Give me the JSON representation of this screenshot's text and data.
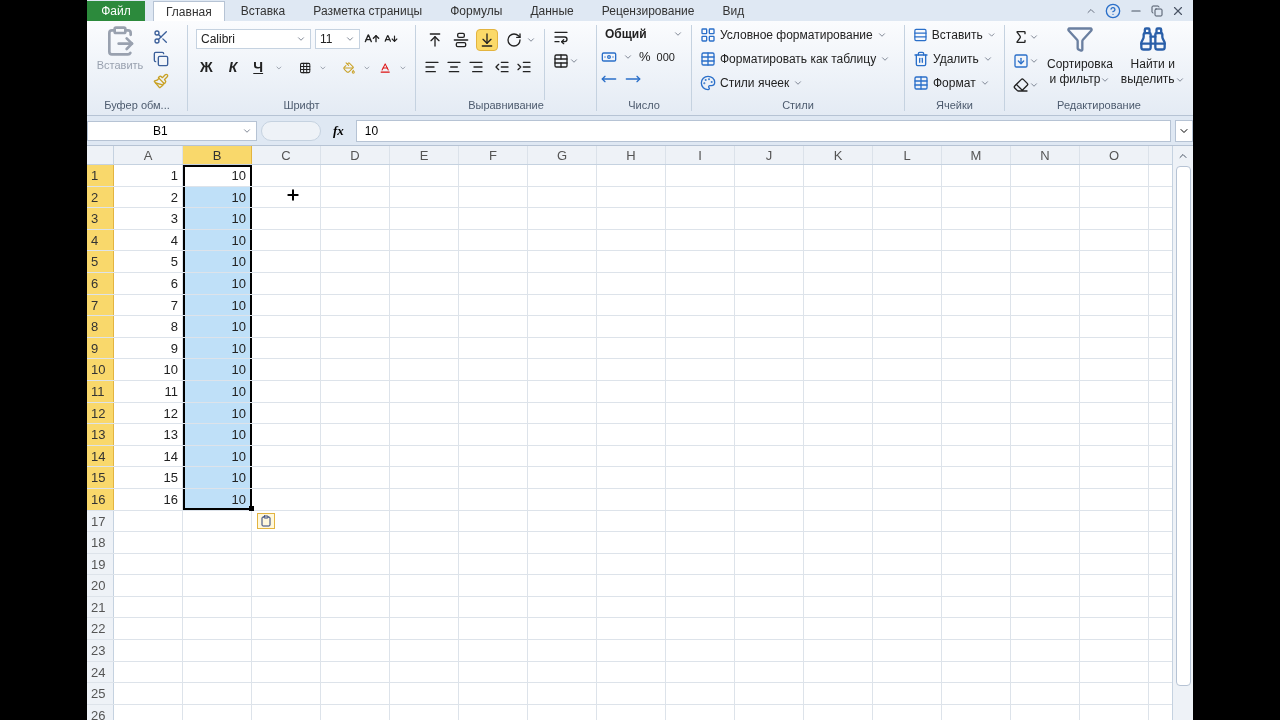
{
  "file_tab": "Файл",
  "tabs": [
    {
      "label": "Главная",
      "selected": true
    },
    {
      "label": "Вставка",
      "selected": false
    },
    {
      "label": "Разметка страницы",
      "selected": false
    },
    {
      "label": "Формулы",
      "selected": false
    },
    {
      "label": "Данные",
      "selected": false
    },
    {
      "label": "Рецензирование",
      "selected": false
    },
    {
      "label": "Вид",
      "selected": false
    }
  ],
  "clipboard": {
    "paste_label": "Вставить",
    "group_label": "Буфер обм..."
  },
  "font": {
    "font_name": "Calibri",
    "font_size": "11",
    "bold": "Ж",
    "italic": "К",
    "underline": "Ч",
    "group_label": "Шрифт"
  },
  "alignment": {
    "vertical": [
      {
        "kind": "top",
        "selected": false
      },
      {
        "kind": "middle",
        "selected": false
      },
      {
        "kind": "bottom",
        "selected": true
      }
    ],
    "group_label": "Выравнивание"
  },
  "number": {
    "format": "Общий",
    "percent": "%",
    "thousands": "000",
    "group_label": "Число"
  },
  "styles": {
    "items": [
      {
        "kind": "conditional",
        "label": "Условное форматирование"
      },
      {
        "kind": "table",
        "label": "Форматировать как таблицу"
      },
      {
        "kind": "cell",
        "label": "Стили ячеек"
      }
    ],
    "group_label": "Стили"
  },
  "cells": {
    "items": [
      {
        "kind": "insert",
        "label": "Вставить"
      },
      {
        "kind": "delete",
        "label": "Удалить"
      },
      {
        "kind": "format",
        "label": "Формат"
      }
    ],
    "group_label": "Ячейки"
  },
  "editing": {
    "sort": [
      "Сортировка",
      "и фильтр"
    ],
    "find": [
      "Найти и",
      "выделить"
    ],
    "group_label": "Редактирование"
  },
  "formula_bar": {
    "name_box": "B1",
    "function_label": "fx",
    "value": "10"
  },
  "columns": [
    {
      "label": "A",
      "selected": false
    },
    {
      "label": "B",
      "selected": true
    },
    {
      "label": "C",
      "selected": false
    },
    {
      "label": "D",
      "selected": false
    },
    {
      "label": "E",
      "selected": false
    },
    {
      "label": "F",
      "selected": false
    },
    {
      "label": "G",
      "selected": false
    },
    {
      "label": "H",
      "selected": false
    },
    {
      "label": "I",
      "selected": false
    },
    {
      "label": "J",
      "selected": false
    },
    {
      "label": "K",
      "selected": false
    },
    {
      "label": "L",
      "selected": false
    },
    {
      "label": "M",
      "selected": false
    },
    {
      "label": "N",
      "selected": false
    },
    {
      "label": "O",
      "selected": false
    }
  ],
  "rows": [
    {
      "label": "1",
      "selected": true,
      "cells": [
        {
          "value": "1",
          "selected": false
        },
        {
          "value": "10",
          "selected": true,
          "active": true
        }
      ]
    },
    {
      "label": "2",
      "selected": true,
      "cells": [
        {
          "value": "2",
          "selected": false
        },
        {
          "value": "10",
          "selected": true,
          "active": false
        }
      ]
    },
    {
      "label": "3",
      "selected": true,
      "cells": [
        {
          "value": "3",
          "selected": false
        },
        {
          "value": "10",
          "selected": true,
          "active": false
        }
      ]
    },
    {
      "label": "4",
      "selected": true,
      "cells": [
        {
          "value": "4",
          "selected": false
        },
        {
          "value": "10",
          "selected": true,
          "active": false
        }
      ]
    },
    {
      "label": "5",
      "selected": true,
      "cells": [
        {
          "value": "5",
          "selected": false
        },
        {
          "value": "10",
          "selected": true,
          "active": false
        }
      ]
    },
    {
      "label": "6",
      "selected": true,
      "cells": [
        {
          "value": "6",
          "selected": false
        },
        {
          "value": "10",
          "selected": true,
          "active": false
        }
      ]
    },
    {
      "label": "7",
      "selected": true,
      "cells": [
        {
          "value": "7",
          "selected": false
        },
        {
          "value": "10",
          "selected": true,
          "active": false
        }
      ]
    },
    {
      "label": "8",
      "selected": true,
      "cells": [
        {
          "value": "8",
          "selected": false
        },
        {
          "value": "10",
          "selected": true,
          "active": false
        }
      ]
    },
    {
      "label": "9",
      "selected": true,
      "cells": [
        {
          "value": "9",
          "selected": false
        },
        {
          "value": "10",
          "selected": true,
          "active": false
        }
      ]
    },
    {
      "label": "10",
      "selected": true,
      "cells": [
        {
          "value": "10",
          "selected": false
        },
        {
          "value": "10",
          "selected": true,
          "active": false
        }
      ]
    },
    {
      "label": "11",
      "selected": true,
      "cells": [
        {
          "value": "11",
          "selected": false
        },
        {
          "value": "10",
          "selected": true,
          "active": false
        }
      ]
    },
    {
      "label": "12",
      "selected": true,
      "cells": [
        {
          "value": "12",
          "selected": false
        },
        {
          "value": "10",
          "selected": true,
          "active": false
        }
      ]
    },
    {
      "label": "13",
      "selected": true,
      "cells": [
        {
          "value": "13",
          "selected": false
        },
        {
          "value": "10",
          "selected": true,
          "active": false
        }
      ]
    },
    {
      "label": "14",
      "selected": true,
      "cells": [
        {
          "value": "14",
          "selected": false
        },
        {
          "value": "10",
          "selected": true,
          "active": false
        }
      ]
    },
    {
      "label": "15",
      "selected": true,
      "cells": [
        {
          "value": "15",
          "selected": false
        },
        {
          "value": "10",
          "selected": true,
          "active": false
        }
      ]
    },
    {
      "label": "16",
      "selected": true,
      "cells": [
        {
          "value": "16",
          "selected": false
        },
        {
          "value": "10",
          "selected": true,
          "active": false
        }
      ]
    },
    {
      "label": "17",
      "selected": false,
      "cells": []
    },
    {
      "label": "18",
      "selected": false,
      "cells": []
    },
    {
      "label": "19",
      "selected": false,
      "cells": []
    },
    {
      "label": "20",
      "selected": false,
      "cells": []
    },
    {
      "label": "21",
      "selected": false,
      "cells": []
    },
    {
      "label": "22",
      "selected": false,
      "cells": []
    },
    {
      "label": "23",
      "selected": false,
      "cells": []
    },
    {
      "label": "24",
      "selected": false,
      "cells": []
    },
    {
      "label": "25",
      "selected": false,
      "cells": []
    },
    {
      "label": "26",
      "selected": false,
      "cells": []
    }
  ]
}
